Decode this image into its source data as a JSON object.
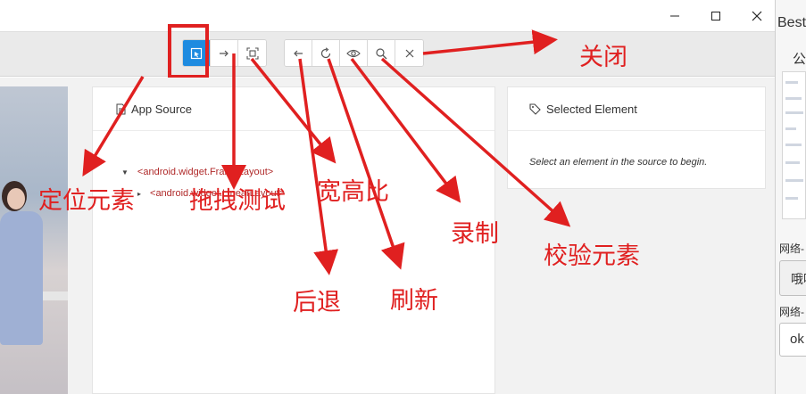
{
  "window": {
    "controls": [
      "—",
      "☐",
      "✕"
    ]
  },
  "toolbar": {
    "group1": [
      {
        "name": "select-element-button",
        "icon": "select-cursor-icon",
        "active": true
      },
      {
        "name": "swipe-button",
        "icon": "arrow-right-icon",
        "active": false
      },
      {
        "name": "tap-coordinates-button",
        "icon": "crop-frame-icon",
        "active": false
      }
    ],
    "group2": [
      {
        "name": "back-button",
        "icon": "arrow-left-icon"
      },
      {
        "name": "refresh-button",
        "icon": "refresh-icon"
      },
      {
        "name": "record-button",
        "icon": "eye-icon"
      },
      {
        "name": "search-element-button",
        "icon": "search-icon"
      },
      {
        "name": "quit-session-button",
        "icon": "close-icon"
      }
    ],
    "accent": "#1e8be0"
  },
  "source_panel": {
    "title": "App Source",
    "tree": [
      "<android.widget.FrameLayout>",
      "<android.widget.LinearLayout>"
    ]
  },
  "selected_panel": {
    "title": "Selected Element",
    "hint": "Select an element in the source to begin."
  },
  "right_window": {
    "title_fragment": "Best",
    "char1": "公",
    "label1": "网络-",
    "box1": "哦吖",
    "label2": "网络-",
    "box2": "ok"
  },
  "annotations": {
    "color": "#e02020",
    "locate": "定位元素",
    "drag": "拖拽测试",
    "ratio": "宽高比",
    "back": "后退",
    "refresh": "刷新",
    "record": "录制",
    "verify": "校验元素",
    "close": "关闭"
  }
}
